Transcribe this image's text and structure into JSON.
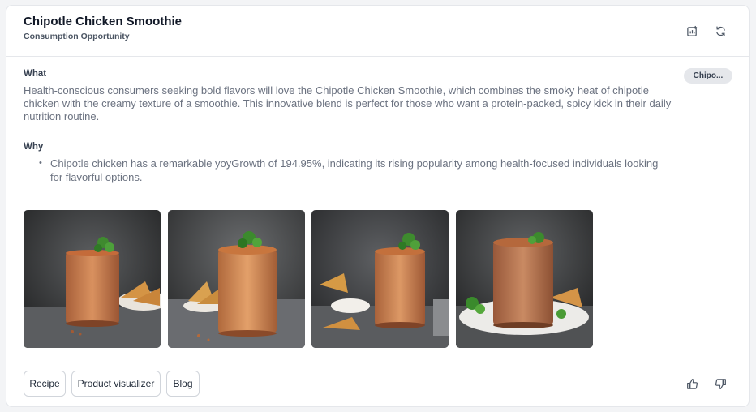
{
  "card": {
    "title": "Chipotle Chicken Smoothie",
    "subtitle": "Consumption Opportunity",
    "header_icons": [
      "chart-add-icon",
      "refresh-icon"
    ]
  },
  "what": {
    "label": "What",
    "text": "Health-conscious consumers seeking bold flavors will love the Chipotle Chicken Smoothie, which combines the smoky heat of chipotle chicken with the creamy texture of a smoothie. This innovative blend is perfect for those who want a protein-packed, spicy kick in their daily nutrition routine."
  },
  "why": {
    "label": "Why",
    "items": [
      "Chipotle chicken has a remarkable yoyGrowth of 194.95%, indicating its rising popularity among health-focused individuals looking for flavorful options."
    ]
  },
  "tag": {
    "label": "Chipo..."
  },
  "images": [
    {
      "name": "smoothie-image-1"
    },
    {
      "name": "smoothie-image-2"
    },
    {
      "name": "smoothie-image-3"
    },
    {
      "name": "smoothie-image-4"
    }
  ],
  "actions": [
    {
      "label": "Recipe"
    },
    {
      "label": "Product visualizer"
    },
    {
      "label": "Blog"
    }
  ],
  "feedback": {
    "icons": [
      "thumbs-up-icon",
      "thumbs-down-icon"
    ]
  },
  "colors": {
    "border": "#e5e7eb",
    "muted_text": "#6b7280",
    "chip_bg": "#e5e7eb"
  }
}
